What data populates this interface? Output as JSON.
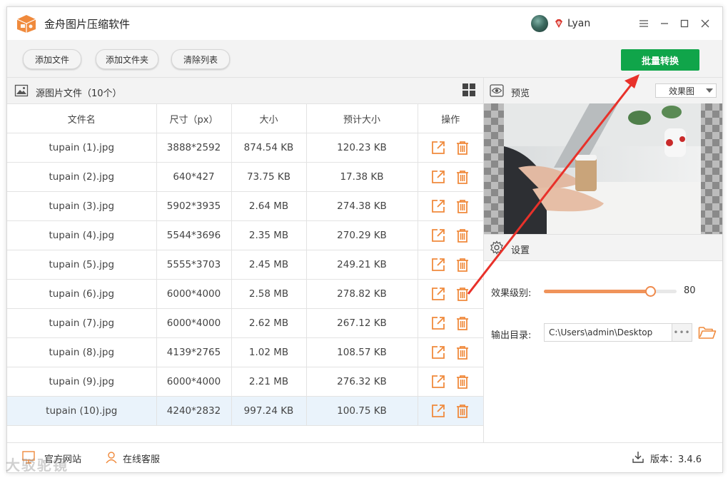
{
  "app": {
    "title": "金舟图片压缩软件",
    "username": "Lyan"
  },
  "toolbar": {
    "add_file": "添加文件",
    "add_folder": "添加文件夹",
    "clear_list": "清除列表",
    "batch_convert": "批量转换"
  },
  "file_list": {
    "title": "源图片文件（10个）",
    "columns": [
      "文件名",
      "尺寸（px）",
      "大小",
      "预计大小",
      "操作"
    ],
    "rows": [
      {
        "name": "tupain (1).jpg",
        "dims": "3888*2592",
        "size": "874.54 KB",
        "est": "120.23 KB"
      },
      {
        "name": "tupain (2).jpg",
        "dims": "640*427",
        "size": "73.75 KB",
        "est": "17.38 KB"
      },
      {
        "name": "tupain (3).jpg",
        "dims": "5902*3935",
        "size": "2.64 MB",
        "est": "274.38 KB"
      },
      {
        "name": "tupain (4).jpg",
        "dims": "5544*3696",
        "size": "2.35 MB",
        "est": "270.29 KB"
      },
      {
        "name": "tupain (5).jpg",
        "dims": "5555*3703",
        "size": "2.45 MB",
        "est": "249.21 KB"
      },
      {
        "name": "tupain (6).jpg",
        "dims": "6000*4000",
        "size": "2.58 MB",
        "est": "278.82 KB"
      },
      {
        "name": "tupain (7).jpg",
        "dims": "6000*4000",
        "size": "2.62 MB",
        "est": "267.12 KB"
      },
      {
        "name": "tupain (8).jpg",
        "dims": "4139*2765",
        "size": "1.02 MB",
        "est": "108.57 KB"
      },
      {
        "name": "tupain (9).jpg",
        "dims": "6000*4000",
        "size": "2.21 MB",
        "est": "276.32 KB"
      },
      {
        "name": "tupain (10).jpg",
        "dims": "4240*2832",
        "size": "997.24 KB",
        "est": "100.75 KB"
      }
    ],
    "selected_index": 9
  },
  "preview": {
    "title": "预览",
    "view_mode": "效果图"
  },
  "settings": {
    "title": "设置",
    "level_label": "效果级别:",
    "level_value": "80",
    "level_fraction": 0.8,
    "output_label": "输出目录:",
    "output_path": "C:\\Users\\admin\\Desktop",
    "more": "•••"
  },
  "statusbar": {
    "website": "官方网站",
    "support": "在线客服",
    "version": "版本：3.4.6"
  },
  "watermark": "大驳驼镜",
  "colors": {
    "accent_green": "#10a54a",
    "accent_orange": "#ef8a4c",
    "annotation_red": "#e8312a"
  }
}
